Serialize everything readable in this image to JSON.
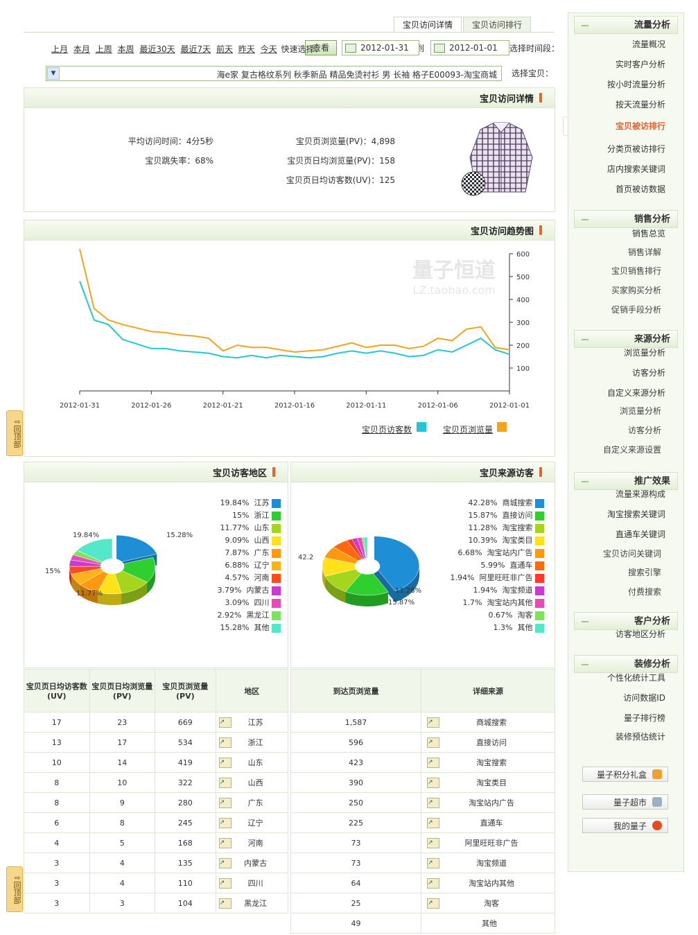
{
  "tabs": [
    "宝贝访问详情",
    "宝贝访问排行"
  ],
  "filter": {
    "time_label": "选择时间段：",
    "date_from": "2012-01-01",
    "date_to_sep": "到",
    "date_to": "2012-01-31",
    "view_button": "查看",
    "quick_label": "快速选择：",
    "quick_links": [
      "今天",
      "昨天",
      "前天",
      "最近7天",
      "最近30天",
      "本周",
      "上周",
      "本月",
      "上月"
    ],
    "item_label": "选择宝贝：",
    "item_value": "海e家 复古格纹系列 秋季新品 精品免烫衬衫 男 长袖 格子E00093-淘宝商城"
  },
  "detail": {
    "title": "宝贝访问详情",
    "stats": [
      {
        "label": "宝贝页浏览量(PV)：",
        "value": "4,898"
      },
      {
        "label": "宝贝页日均浏览量(PV)：",
        "value": "158"
      },
      {
        "label": "宝贝页日均访客数(UV)：",
        "value": "125"
      },
      {
        "label": "平均访问时间：",
        "value": "4分5秒"
      },
      {
        "label": "宝贝跳失率：",
        "value": "68%"
      }
    ]
  },
  "trend": {
    "title": "宝贝访问趋势图",
    "watermark_cn": "量子恒道",
    "watermark_en": "LZ.taobao.com",
    "legend": [
      "宝贝页浏览量",
      "宝贝页访客数"
    ],
    "colors": {
      "pv": "#f4a31d",
      "uv": "#22c7d4"
    }
  },
  "chart_data": [
    {
      "type": "line",
      "x": [
        "2012-01-01",
        "2012-01-02",
        "2012-01-03",
        "2012-01-04",
        "2012-01-05",
        "2012-01-06",
        "2012-01-07",
        "2012-01-08",
        "2012-01-09",
        "2012-01-10",
        "2012-01-11",
        "2012-01-12",
        "2012-01-13",
        "2012-01-14",
        "2012-01-15",
        "2012-01-16",
        "2012-01-17",
        "2012-01-18",
        "2012-01-19",
        "2012-01-20",
        "2012-01-21",
        "2012-01-22",
        "2012-01-23",
        "2012-01-24",
        "2012-01-25",
        "2012-01-26",
        "2012-01-27",
        "2012-01-28",
        "2012-01-29",
        "2012-01-30",
        "2012-01-31"
      ],
      "xticks": [
        "2012-01-01",
        "2012-01-06",
        "2012-01-11",
        "2012-01-16",
        "2012-01-21",
        "2012-01-26",
        "2012-01-31"
      ],
      "yticks": [
        100,
        200,
        300,
        400,
        500,
        600
      ],
      "ylim": [
        0,
        600
      ],
      "series": [
        {
          "name": "宝贝页浏览量",
          "values": [
            180,
            190,
            280,
            270,
            220,
            230,
            195,
            185,
            200,
            200,
            190,
            210,
            195,
            180,
            175,
            170,
            180,
            190,
            190,
            200,
            175,
            230,
            240,
            245,
            255,
            260,
            275,
            290,
            310,
            360,
            620
          ]
        },
        {
          "name": "宝贝页访客数",
          "values": [
            160,
            180,
            230,
            200,
            170,
            180,
            155,
            150,
            165,
            175,
            165,
            175,
            165,
            150,
            145,
            150,
            155,
            145,
            155,
            145,
            150,
            165,
            170,
            175,
            185,
            185,
            205,
            225,
            290,
            310,
            480
          ]
        }
      ]
    },
    {
      "type": "pie",
      "title": "宝贝来源访客",
      "categories": [
        "商城搜索",
        "直接访问",
        "淘宝搜索",
        "淘宝类目",
        "淘宝站内广告",
        "直通车",
        "阿里旺旺非广告",
        "淘宝频道",
        "淘宝站内其他",
        "淘客",
        "其他"
      ],
      "values": [
        42.28,
        15.87,
        11.28,
        10.39,
        6.68,
        5.99,
        1.94,
        1.94,
        1.7,
        0.67,
        1.3
      ],
      "labels": [
        "42.28%",
        "15.87%",
        "11.28%",
        "10.39%",
        "6.68%",
        "5.99%",
        "1.94%",
        "1.94%",
        "1.7%",
        "0.67%",
        "1.3%"
      ],
      "callouts": [
        "42.2",
        "15.87%",
        "11.28%"
      ],
      "colors": [
        "#1e8fd6",
        "#2fcf2f",
        "#a5d51c",
        "#ffe21a",
        "#ff9a10",
        "#ff6a10",
        "#ff3a2a",
        "#c93ad1",
        "#e84bb4",
        "#7fe35a",
        "#52e8c9"
      ]
    },
    {
      "type": "pie",
      "title": "宝贝访客地区",
      "categories": [
        "江苏",
        "浙江",
        "山东",
        "山西",
        "广东",
        "辽宁",
        "河南",
        "内蒙古",
        "四川",
        "黑龙江",
        "其他"
      ],
      "values": [
        19.84,
        15,
        11.77,
        9.09,
        7.87,
        6.88,
        4.57,
        3.79,
        3.09,
        2.92,
        15.28
      ],
      "labels": [
        "19.84%",
        "15%",
        "11.77%",
        "9.09%",
        "7.87%",
        "6.88%",
        "4.57%",
        "3.79%",
        "3.09%",
        "2.92%",
        "15.28%"
      ],
      "callouts": [
        "19.84%",
        "15%",
        "11.77%",
        "15.28%"
      ],
      "colors": [
        "#1e8fd6",
        "#2fcf2f",
        "#a5d51c",
        "#ffe21a",
        "#ff9a10",
        "#ffb21a",
        "#ff4a20",
        "#c93ad1",
        "#e84bb4",
        "#7fe35a",
        "#52e8c9"
      ]
    }
  ],
  "source_table": {
    "headers": [
      "详细来源",
      "到达页浏览量"
    ],
    "rows": [
      [
        "商城搜索",
        "1,587"
      ],
      [
        "直接访问",
        "596"
      ],
      [
        "淘宝搜索",
        "423"
      ],
      [
        "淘宝类目",
        "390"
      ],
      [
        "淘宝站内广告",
        "250"
      ],
      [
        "直通车",
        "225"
      ],
      [
        "阿里旺旺非广告",
        "73"
      ],
      [
        "淘宝频道",
        "73"
      ],
      [
        "淘宝站内其他",
        "64"
      ],
      [
        "淘客",
        "25"
      ],
      [
        "其他",
        "49"
      ]
    ]
  },
  "region_table": {
    "headers": [
      "地区",
      "宝贝页浏览量(PV)",
      "宝贝页日均浏览量(PV)",
      "宝贝页日均访客数(UV)"
    ],
    "rows": [
      [
        "江苏",
        "669",
        "23",
        "17"
      ],
      [
        "浙江",
        "534",
        "17",
        "13"
      ],
      [
        "山东",
        "419",
        "14",
        "10"
      ],
      [
        "山西",
        "322",
        "10",
        "8"
      ],
      [
        "广东",
        "280",
        "9",
        "8"
      ],
      [
        "辽宁",
        "245",
        "8",
        "6"
      ],
      [
        "河南",
        "168",
        "5",
        "4"
      ],
      [
        "内蒙古",
        "135",
        "4",
        "3"
      ],
      [
        "四川",
        "110",
        "4",
        "3"
      ],
      [
        "黑龙江",
        "104",
        "3",
        "3"
      ]
    ]
  },
  "sidebar": {
    "groups": [
      {
        "title": "流量分析",
        "items": [
          "流量概况",
          "实时客户分析",
          "按小时流量分析",
          "按天流量分析",
          "宝贝被访排行",
          "分类页被访排行",
          "店内搜索关键词",
          "首页被访数据"
        ]
      },
      {
        "title": "销售分析",
        "items": [
          "销售总览",
          "销售详解",
          "宝贝销售排行",
          "买家购买分析",
          "促销手段分析"
        ]
      },
      {
        "title": "来源分析",
        "items": [
          "浏览量分析",
          "访客分析",
          "自定义来源分析",
          "浏览量分析",
          "访客分析",
          "自定义来源设置"
        ]
      },
      {
        "title": "推广效果",
        "items": [
          "流量来源构成",
          "淘宝搜索关键词",
          "直通车关键词",
          "宝贝访问关键词",
          "搜索引擎",
          "付费搜索"
        ]
      },
      {
        "title": "客户分析",
        "items": [
          "访客地区分析"
        ]
      },
      {
        "title": "装修分析",
        "items": [
          "个性化统计工具",
          "访问数据ID",
          "量子排行榜",
          "装修预估统计"
        ]
      }
    ],
    "buttons": [
      "量子积分礼盒",
      "量子超市",
      "我的量子"
    ]
  },
  "back_top": "回顶部"
}
